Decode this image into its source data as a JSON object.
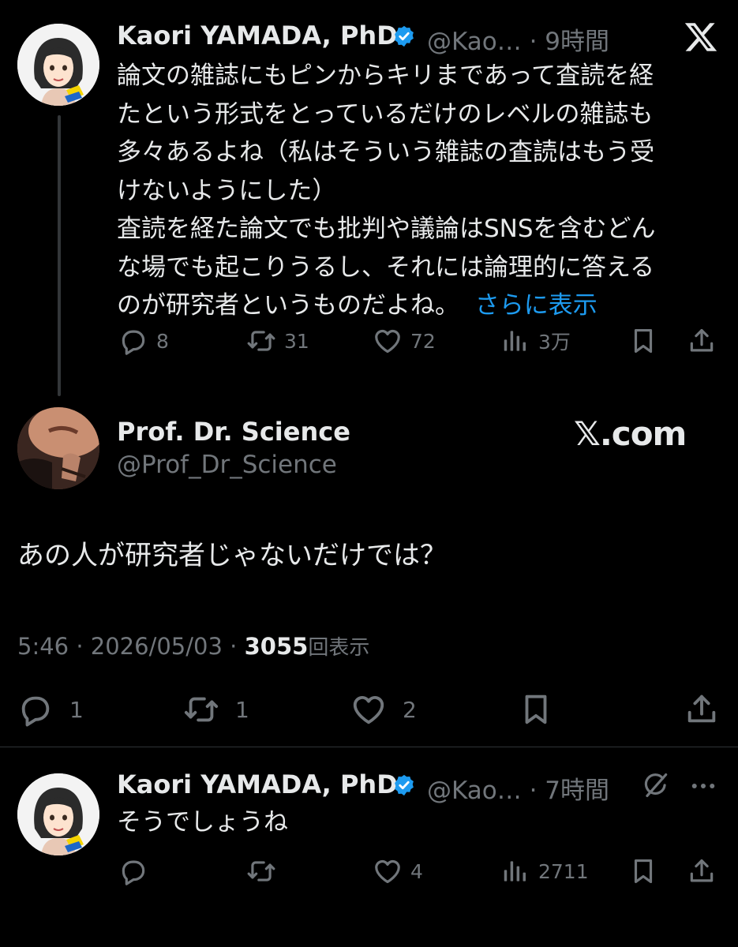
{
  "tweet1": {
    "name": "Kaori YAMADA, PhD",
    "handle": "@Kao… · 9時間",
    "lines": [
      "論文の雑誌にもピンからキリまであって査読を経",
      "たという形式をとっているだけのレベルの雑誌も",
      "多々あるよね（私はそういう雑誌の査読はもう受",
      "けないようにした）",
      "査読を経た論文でも批判や議論はSNSを含むどん",
      "な場でも起こりうるし、それには論理的に答える",
      "のが研究者というものだよね。"
    ],
    "show_more": "さらに表示",
    "replies": "8",
    "reposts": "31",
    "likes": "72",
    "views": "3万"
  },
  "tweet2": {
    "name": "Prof. Dr. Science",
    "handle": "@Prof_Dr_Science",
    "brand": "𝕏.com",
    "text": "あの人が研究者じゃないだけでは？",
    "time": "5:46 · 2026/05/03 · ",
    "views_count": "3055",
    "views_label": "回表示",
    "replies": "1",
    "reposts": "1",
    "likes": "2"
  },
  "tweet3": {
    "name": "Kaori YAMADA, PhD",
    "handle": "@Kao… · 7時間",
    "text": "そうでしょうね",
    "replies": "",
    "reposts": "",
    "likes": "4",
    "views": "2711"
  },
  "colors": {
    "background": "#000000",
    "text": "#e7e9ea",
    "secondary": "#71767b",
    "link": "#1d9bf0",
    "verified": "#1d9bf0"
  },
  "icons": [
    "x-logo-icon",
    "verified-badge-icon",
    "reply-icon",
    "repost-icon",
    "like-icon",
    "views-icon",
    "bookmark-icon",
    "share-icon",
    "grok-icon",
    "more-icon"
  ]
}
